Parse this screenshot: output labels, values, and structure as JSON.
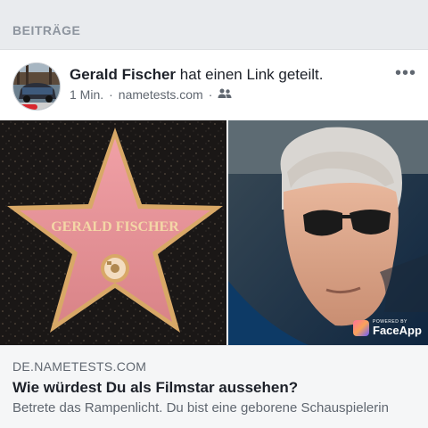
{
  "section": {
    "title": "BEITRÄGE"
  },
  "post": {
    "author": "Gerald Fischer",
    "action_text": "hat einen Link geteilt.",
    "time": "1 Min.",
    "separator": "·",
    "source": "nametests.com",
    "audience_icon": "friends-icon",
    "more_icon": "more-options-icon",
    "more_label": "•••"
  },
  "media": {
    "star_name": "GERALD FISCHER",
    "badge_small": "POWERED BY",
    "badge_name": "FaceApp"
  },
  "link": {
    "domain": "DE.NAMETESTS.COM",
    "title": "Wie würdest Du als Filmstar aussehen?",
    "description": "Betrete das Rampenlicht. Du bist eine geborene Schauspielerin"
  },
  "colors": {
    "header_bg": "#e9ebee",
    "text_primary": "#1d2129",
    "text_secondary": "#606770",
    "link_bg": "#f5f6f7"
  }
}
